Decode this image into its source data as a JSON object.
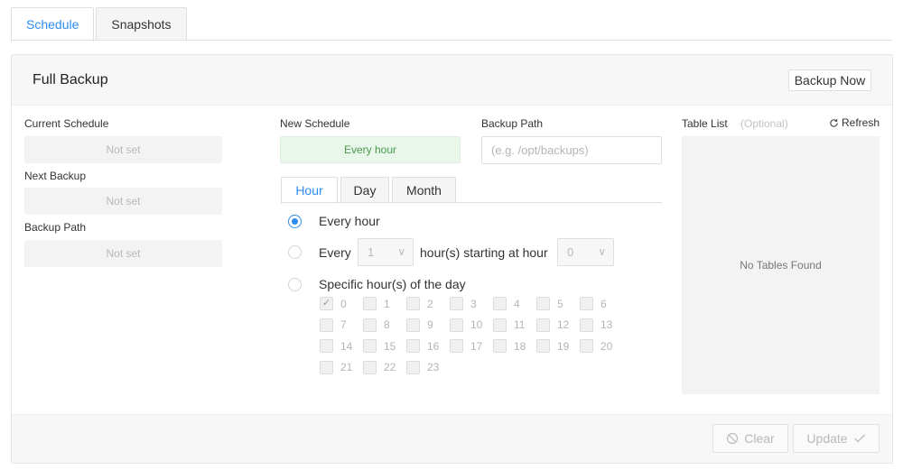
{
  "tabs": {
    "schedule": "Schedule",
    "snapshots": "Snapshots"
  },
  "panel": {
    "title": "Full Backup",
    "backup_now": "Backup Now"
  },
  "left": {
    "current_schedule_label": "Current Schedule",
    "current_schedule_value": "Not set",
    "next_backup_label": "Next Backup",
    "next_backup_value": "Not set",
    "backup_path_label": "Backup Path",
    "backup_path_value": "Not set"
  },
  "middle": {
    "new_schedule_label": "New Schedule",
    "new_schedule_value": "Every hour",
    "backup_path_label": "Backup Path",
    "backup_path_placeholder": "(e.g. /opt/backups)",
    "inner_tabs": {
      "hour": "Hour",
      "day": "Day",
      "month": "Month"
    },
    "options": {
      "every_hour": "Every hour",
      "every": "Every",
      "every_select_value": "1",
      "starting_at": "hour(s) starting at hour",
      "start_select_value": "0",
      "specific": "Specific hour(s) of the day"
    },
    "hours": [
      "0",
      "1",
      "2",
      "3",
      "4",
      "5",
      "6",
      "7",
      "8",
      "9",
      "10",
      "11",
      "12",
      "13",
      "14",
      "15",
      "16",
      "17",
      "18",
      "19",
      "20",
      "21",
      "22",
      "23"
    ],
    "checked_hours": [
      "0"
    ]
  },
  "right": {
    "table_list_label": "Table List",
    "optional": "(Optional)",
    "refresh": "Refresh",
    "empty_text": "No Tables Found"
  },
  "footer": {
    "clear": "Clear",
    "update": "Update"
  },
  "colors": {
    "accent": "#2d8cf0",
    "success_bg": "#e9f6ea",
    "success_text": "#4a9a4f"
  }
}
